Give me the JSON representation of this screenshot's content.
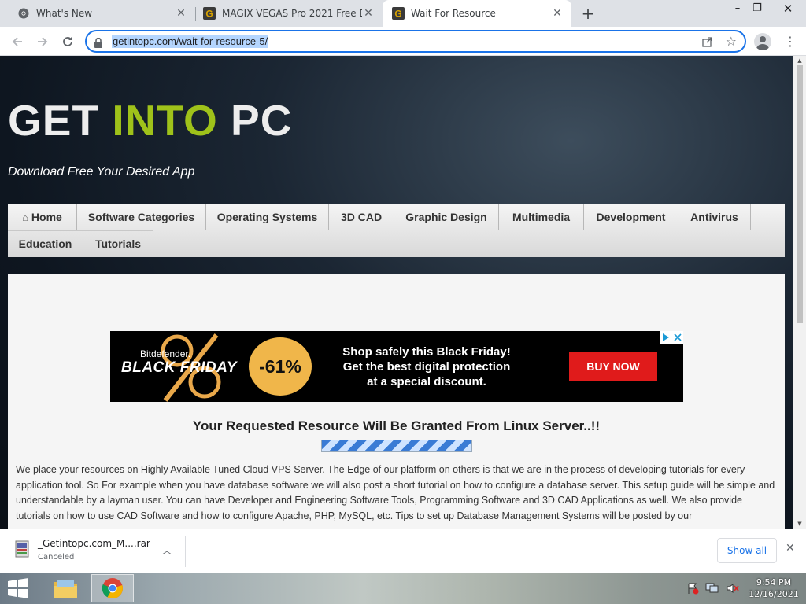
{
  "browser": {
    "tabs": [
      {
        "title": "What's New",
        "active": false,
        "icon": "chrome-icon"
      },
      {
        "title": "MAGIX VEGAS Pro 2021 Free Do",
        "active": false,
        "icon": "getintopc-favicon"
      },
      {
        "title": "Wait For Resource",
        "active": true,
        "icon": "getintopc-favicon"
      }
    ],
    "url": "getintopc.com/wait-for-resource-5/",
    "window_controls": [
      "minimize",
      "maximize",
      "close"
    ]
  },
  "site": {
    "brand_left": "GET ",
    "brand_accent": "INTO",
    "brand_right": " PC",
    "tagline": "Download Free Your Desired App",
    "nav": [
      "Home",
      "Software Categories",
      "Operating Systems",
      "3D CAD",
      "Graphic Design",
      "Multimedia",
      "Development",
      "Antivirus",
      "Education",
      "Tutorials"
    ]
  },
  "ad": {
    "brand": "Bitdefender.",
    "event": "BLACK FRIDAY",
    "discount": "-61%",
    "line1": "Shop safely this Black Friday!",
    "line2": "Get the best digital protection",
    "line3": "at a special discount.",
    "cta": "BUY NOW"
  },
  "main": {
    "headline": "Your Requested Resource Will Be Granted From Linux Server..!!",
    "paragraph": "We place your resources on Highly Available Tuned Cloud VPS Server. The Edge of our platform on others is that we are in the process of developing tutorials for every application tool. So For example when you have database software we will also post a short tutorial on how to configure a database server. This setup guide will be simple and understandable by a layman user. You can have Developer and Engineering Software Tools, Programming Software and 3D CAD Applications as well. We also provide tutorials on how to use CAD Software and how to configure Apache, PHP, MySQL, etc. Tips to set up Database Management Systems will be posted by our"
  },
  "download": {
    "filename": "_Getintopc.com_M....rar",
    "status": "Canceled",
    "show_all": "Show all"
  },
  "taskbar": {
    "time": "9:54 PM",
    "date": "12/16/2021"
  },
  "colors": {
    "brand_accent": "#9fc21a",
    "omnibox_focus": "#1a73e8",
    "ad_button": "#e01b1b"
  }
}
